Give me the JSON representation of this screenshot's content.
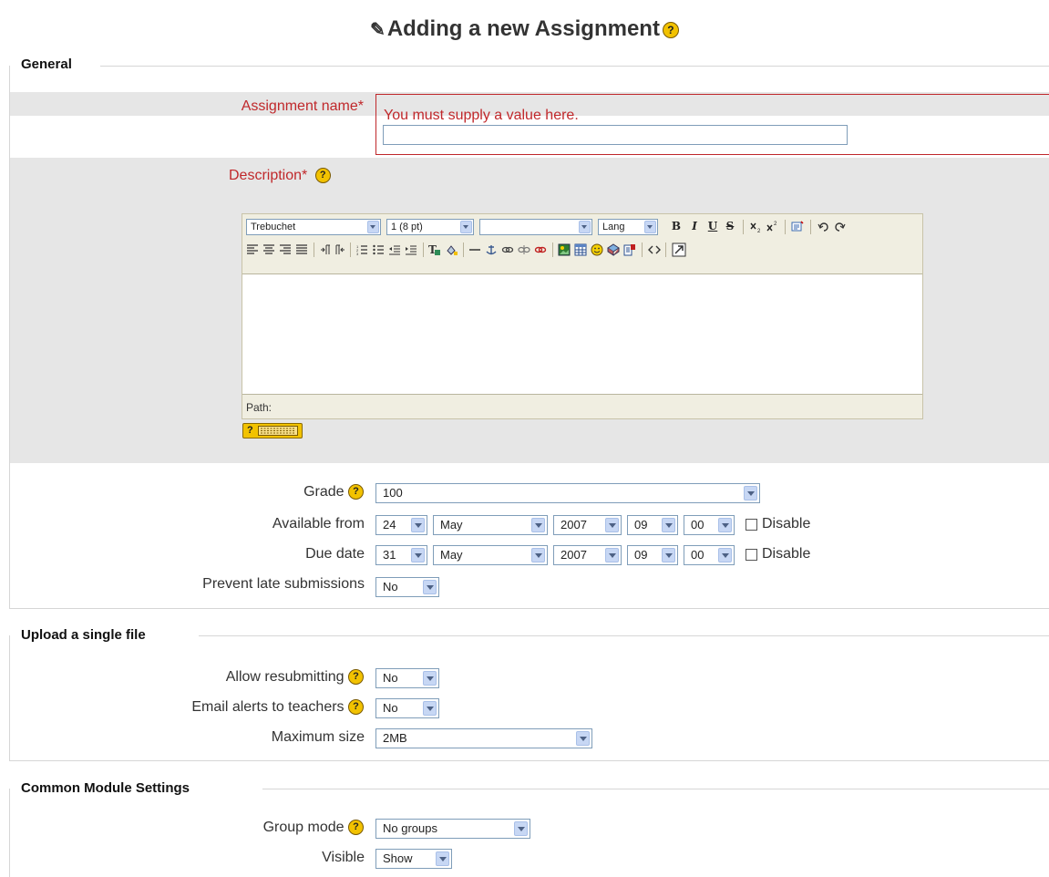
{
  "page": {
    "title": "Adding a new Assignment",
    "help_glyph": "?"
  },
  "general": {
    "legend": "General",
    "assignment_name": {
      "label": "Assignment name*",
      "error": "You must supply a value here.",
      "value": ""
    },
    "description": {
      "label": "Description*",
      "editor": {
        "font": "Trebuchet",
        "size": "1 (8 pt)",
        "style": "",
        "lang": "Lang",
        "bold": "B",
        "italic": "I",
        "underline": "U",
        "strike": "S",
        "path_label": "Path:"
      }
    },
    "grade": {
      "label": "Grade",
      "value": "100"
    },
    "available_from": {
      "label": "Available from",
      "day": "24",
      "month": "May",
      "year": "2007",
      "hour": "09",
      "minute": "00",
      "disable_label": "Disable"
    },
    "due_date": {
      "label": "Due date",
      "day": "31",
      "month": "May",
      "year": "2007",
      "hour": "09",
      "minute": "00",
      "disable_label": "Disable"
    },
    "prevent_late": {
      "label": "Prevent late submissions",
      "value": "No"
    }
  },
  "upload": {
    "legend": "Upload a single file",
    "allow_resubmitting": {
      "label": "Allow resubmitting",
      "value": "No"
    },
    "email_alerts": {
      "label": "Email alerts to teachers",
      "value": "No"
    },
    "maximum_size": {
      "label": "Maximum size",
      "value": "2MB"
    }
  },
  "common": {
    "legend": "Common Module Settings",
    "group_mode": {
      "label": "Group mode",
      "value": "No groups"
    },
    "visible": {
      "label": "Visible",
      "value": "Show"
    }
  },
  "colors": {
    "error": "#c0282b",
    "gray_band": "#e6e6e6",
    "editor_bar": "#f0eee1",
    "help_icon": "#f2c200"
  }
}
